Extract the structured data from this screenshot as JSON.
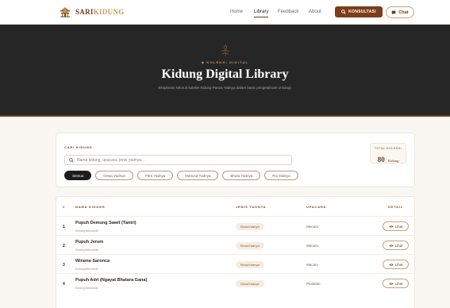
{
  "nav": {
    "brand_part1": "SARI",
    "brand_part2": "KIDUNG",
    "links": [
      "Home",
      "Library",
      "Feedback",
      "About"
    ],
    "active_link": "Library",
    "konsultasi_label": "KONSULTASI",
    "chat_label": "Chat"
  },
  "hero": {
    "kicker": "KOLEKSI DIGITAL",
    "title": "Kidung Digital Library",
    "subtitle": "Eksplorasi seluruh koleksi Kidung Panca Yadnya dalam basis pengetahuan ontologi"
  },
  "search": {
    "label": "CARI KIDUNG",
    "placeholder": "Nama kidung, upacara, jenis yadnya...",
    "filters": [
      "Semua",
      "Dewa Yadnya",
      "Pitra Yadnya",
      "Manusa Yadnya",
      "Bhuta Yadnya",
      "Rsi Yadnya"
    ],
    "active_filter": "Semua",
    "total_label": "TOTAL KOLEKSI",
    "total_value": "80",
    "total_unit": "Kidung"
  },
  "table": {
    "headers": [
      "#",
      "NAMA KIDUNG",
      "JENIS YADNYA",
      "UPACARA",
      "DETAIL"
    ],
    "detail_label": "Lihat",
    "rows": [
      {
        "no": "1",
        "name": "Pupuh Demung Sawit (Tantri)",
        "sub": "KidungSekarAlit",
        "jenis": "BhutaYadnya",
        "upacara": "Mecaru"
      },
      {
        "no": "2",
        "name": "Pupuh Jerum",
        "sub": "KidungSekarAlit",
        "jenis": "BhutaYadnya",
        "upacara": "Mecaru"
      },
      {
        "no": "3",
        "name": "Wirama Saronca",
        "sub": "KidungSekarAlit",
        "jenis": "BhutaYadnya",
        "upacara": "Mecaru"
      },
      {
        "no": "4",
        "name": "Pupuh Adri (Ngayat Bhatara Gana)",
        "sub": "KidungSekarAlit",
        "jenis": "DewaYadnya",
        "upacara": "Piodalan"
      }
    ]
  },
  "colors": {
    "brand": "#7a3e1a",
    "accent_gold": "#c79b5a",
    "hero_bg": "#262626",
    "page_bg": "#faf7f2"
  },
  "icons": [
    "temple-logo-icon",
    "search-icon",
    "chat-bubble-icon",
    "emblem-icon",
    "eye-icon"
  ]
}
